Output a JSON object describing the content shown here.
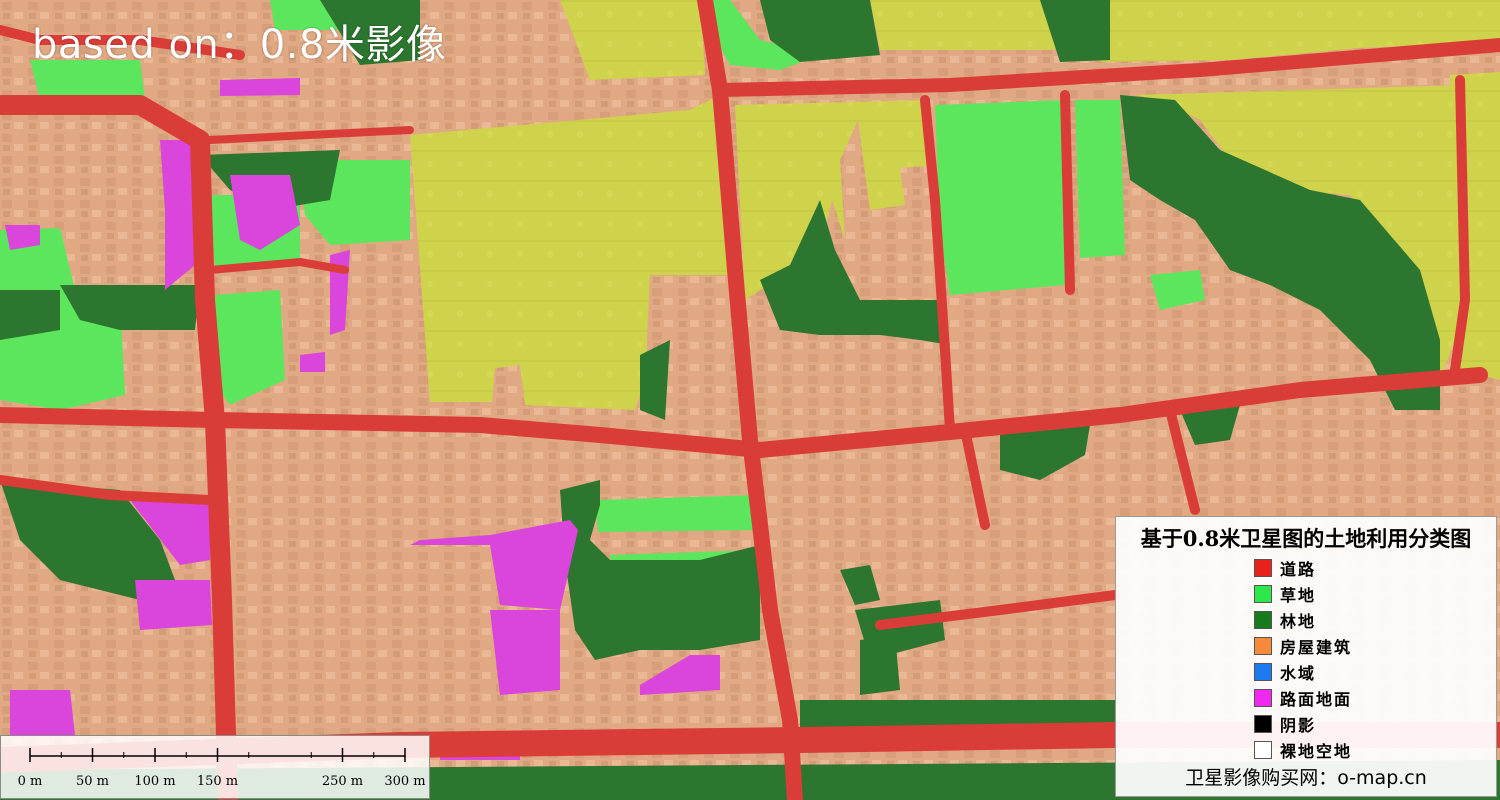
{
  "overlay": {
    "title": "based on：0.8米影像"
  },
  "legend": {
    "title": "基于0.8米卫星图的土地利用分类图",
    "items": [
      {
        "label": "道路",
        "color": "#e8221b"
      },
      {
        "label": "草地",
        "color": "#2ee84a"
      },
      {
        "label": "林地",
        "color": "#177a1c"
      },
      {
        "label": "房屋建筑",
        "color": "#f6893a"
      },
      {
        "label": "水域",
        "color": "#1e7af0"
      },
      {
        "label": "路面地面",
        "color": "#f028f0"
      },
      {
        "label": "阴影",
        "color": "#000000"
      },
      {
        "label": "裸地空地",
        "color": "#ffffff"
      }
    ],
    "footer": "卫星影像购买网：o-map.cn"
  },
  "scalebar": {
    "ticks": [
      {
        "label": "0 m",
        "value": 0
      },
      {
        "label": "50 m",
        "value": 50
      },
      {
        "label": "100 m",
        "value": 100
      },
      {
        "label": "150 m",
        "value": 150
      },
      {
        "label": "250 m",
        "value": 250
      },
      {
        "label": "300 m",
        "value": 300
      }
    ]
  },
  "colors": {
    "road": "#d8312c",
    "grass": "#52e553",
    "forest": "#1f6e22",
    "building": "#e2a57b",
    "pavement": "#d83ad9",
    "cropland": "#cfd042"
  }
}
